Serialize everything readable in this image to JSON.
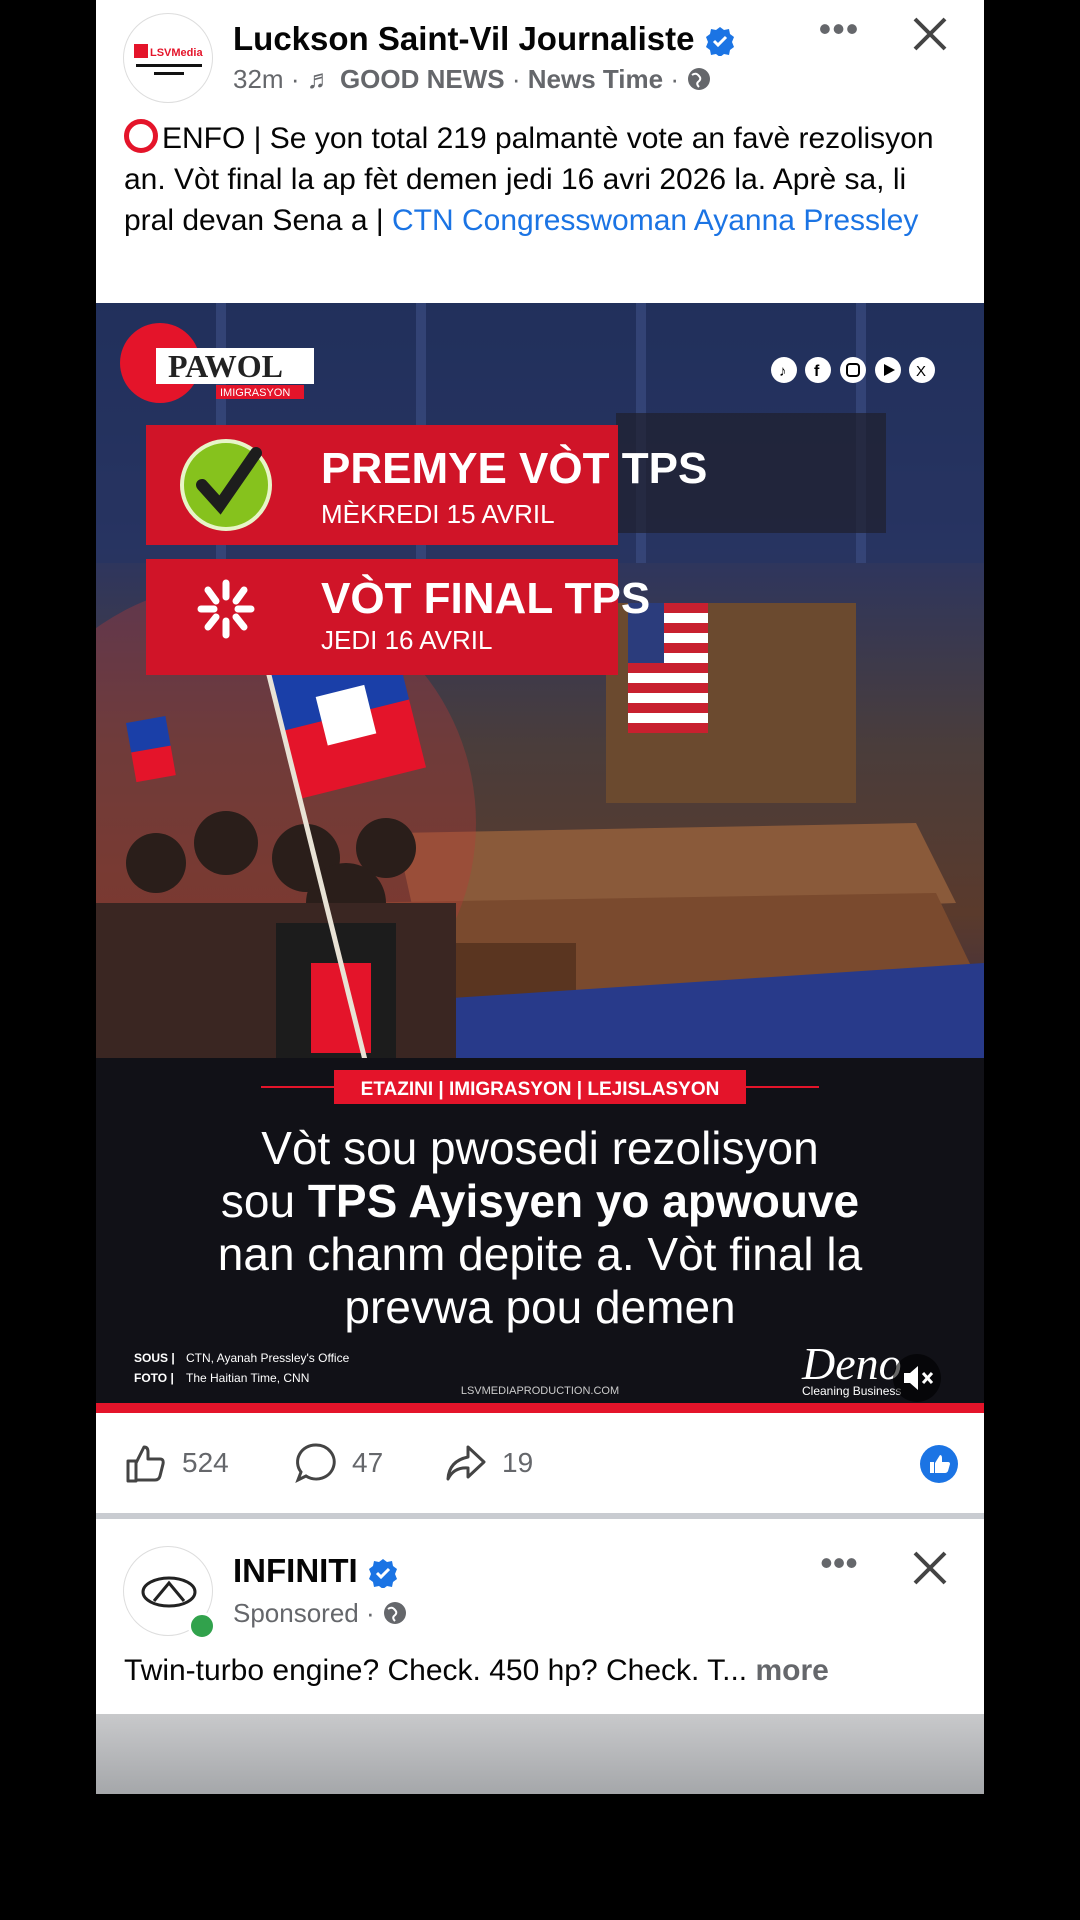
{
  "post": {
    "author": "Luckson Saint-Vil Journaliste",
    "avatar_text": "LSVMedia",
    "time": "32m",
    "music_label": "GOOD NEWS",
    "music_artist": "News Time",
    "text_intro": "ENFO | Se yon total 219 palmantè vote an favè rezolisyon an. Vòt final la ap fèt demen jedi 16 avri 2026 la. Aprè sa, li pral devan Sena a |",
    "text_link": "CTN Congresswoman Ayanna Pressley",
    "image": {
      "brand": "PAWOL",
      "brand_sub": "IMIGRASYON",
      "vote1_title": "PREMYE VÒT TPS",
      "vote1_date": "MÈKREDI 15 AVRIL",
      "vote2_title": "VÒT FINAL TPS",
      "vote2_date": "JEDI 16 AVRIL",
      "tags": "ETAZINI | IMIGRASYON | LEJISLASYON",
      "headline_1": "Vòt sou pwosedi rezolisyon",
      "headline_2a": "sou ",
      "headline_2b": "TPS Ayisyen yo apwouve",
      "headline_3": "nan chanm depite a. Vòt final la",
      "headline_4": "prevwa pou demen",
      "source_label": "SOUS |",
      "source_value": "CTN, Ayanah Pressley's Office",
      "photo_label": "FOTO |",
      "photo_value": "The Haitian Time, CNN",
      "website": "LSVMEDIAPRODUCTION.COM",
      "sponsor": "Deno",
      "sponsor_sub": "Cleaning Business"
    },
    "likes": "524",
    "comments": "47",
    "shares": "19"
  },
  "ad": {
    "name": "INFINITI",
    "label": "Sponsored",
    "text": "Twin-turbo engine? Check. 450 hp? Check. T...",
    "more": "more"
  },
  "colors": {
    "accent": "#1b74e4",
    "red": "#e4142a",
    "meta": "#65676b"
  }
}
